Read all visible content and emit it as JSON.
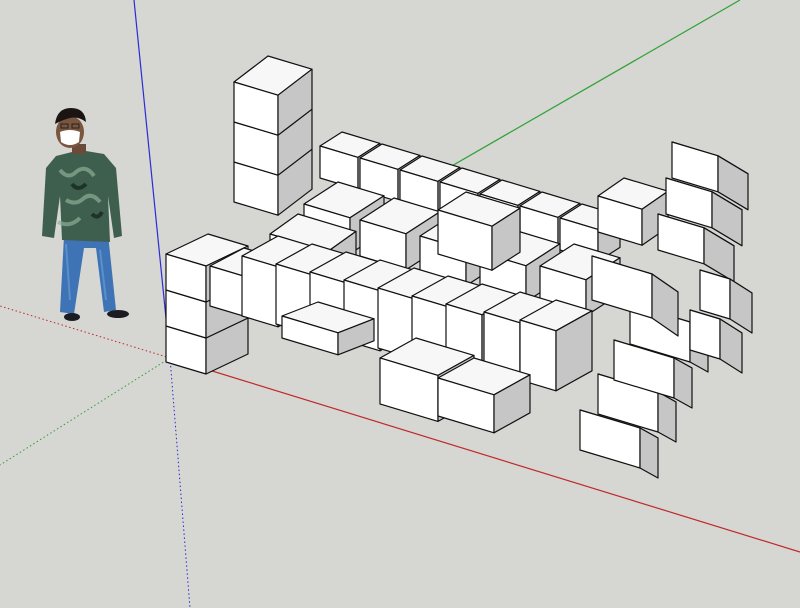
{
  "app": {
    "view": "sketchup-3d-modeling-viewport"
  },
  "scene": {
    "background_color": "#d6d6d3",
    "axes": {
      "red": "#c0282a",
      "green": "#2ea236",
      "blue": "#2b2bd6"
    },
    "figure": {
      "icon": "standing-person-figure-icon",
      "shirt_color": "#3f5f4e",
      "pants_color": "#3e74b5",
      "mask_color": "#ffffff"
    },
    "cube_faces": {
      "top": "#f7f7f7",
      "left": "#ffffff",
      "right": "#c6c6c6",
      "edge": "#111111"
    }
  }
}
